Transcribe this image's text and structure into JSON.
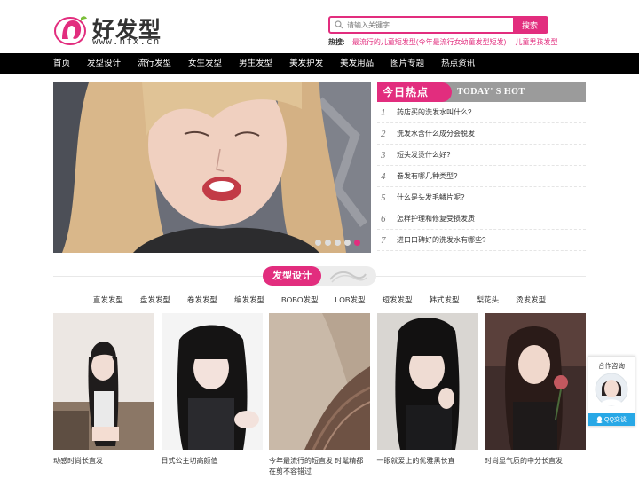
{
  "header": {
    "logo_name": "好发型",
    "logo_url": "www.hfx.cn",
    "search_placeholder": "请输入关键字...",
    "search_button": "搜索",
    "hot_label": "热搜:",
    "hot_links": [
      "最流行的儿童短发型(今年最流行女幼童发型短发)",
      "儿童男孩发型"
    ]
  },
  "nav": [
    "首页",
    "发型设计",
    "流行发型",
    "女生发型",
    "男生发型",
    "美发护发",
    "美发用品",
    "图片专题",
    "热点资讯"
  ],
  "banner": {
    "slide_count": 5,
    "active_slide": 5
  },
  "hot": {
    "title": "今日热点",
    "subtitle": "TODAY' S HOT",
    "items": [
      {
        "num": "1",
        "text": "药店买的洗发水叫什么?"
      },
      {
        "num": "2",
        "text": "洗发水含什么成分会脱发"
      },
      {
        "num": "3",
        "text": "短头发烫什么好?"
      },
      {
        "num": "4",
        "text": "卷发有哪几种类型?"
      },
      {
        "num": "5",
        "text": "什么是头发毛鳞片呢?"
      },
      {
        "num": "6",
        "text": "怎样护理和修复受损发质"
      },
      {
        "num": "7",
        "text": "进口口碑好的洗发水有哪些?"
      }
    ]
  },
  "section": {
    "title": "发型设计",
    "categories": [
      "直发发型",
      "盘发发型",
      "卷发发型",
      "编发发型",
      "BOBO发型",
      "LOB发型",
      "短发发型",
      "韩式发型",
      "梨花头",
      "烫发发型"
    ]
  },
  "cards": [
    {
      "title": "动感时尚长直发"
    },
    {
      "title": "日式公主切高颜值"
    },
    {
      "title": "今年最流行的短直发 时髦精都在剪不容错过"
    },
    {
      "title": "一眼就爱上的优雅黑长直"
    },
    {
      "title": "时尚显气质的中分长直发"
    }
  ],
  "float": {
    "title": "合作咨询",
    "button": "QQ交谈"
  },
  "colors": {
    "accent": "#e22d7e",
    "nav_bg": "#000000",
    "hot_head_bg": "#9b9b9b",
    "qq_blue": "#28a8e6"
  }
}
